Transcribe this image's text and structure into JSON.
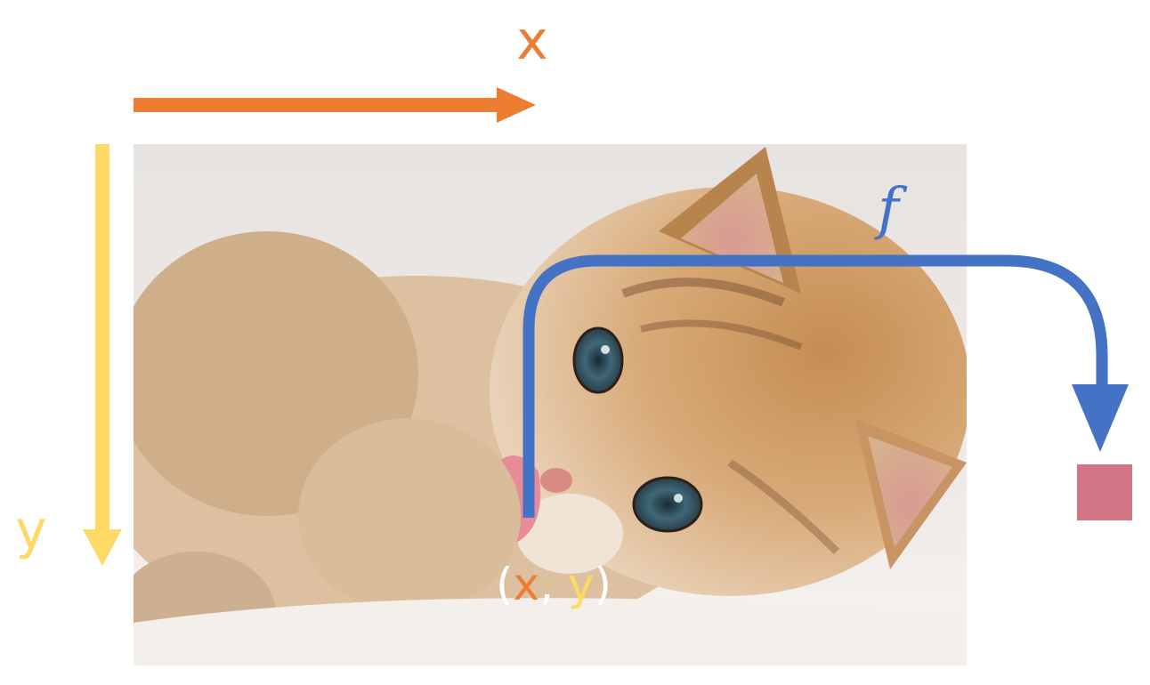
{
  "labels": {
    "x_axis": "x",
    "y_axis": "y",
    "function": "f",
    "coordinate": {
      "open": "(",
      "x": "x",
      "comma": ", ",
      "y": "y",
      "close": ")"
    }
  },
  "colors": {
    "x_axis": "#ED7D31",
    "y_axis": "#FFD966",
    "function_arrow": "#4472C4",
    "output_pixel": "#D47585",
    "coordinate_paren": "#FFFFFF"
  },
  "image": {
    "subject": "kitten-photo"
  }
}
